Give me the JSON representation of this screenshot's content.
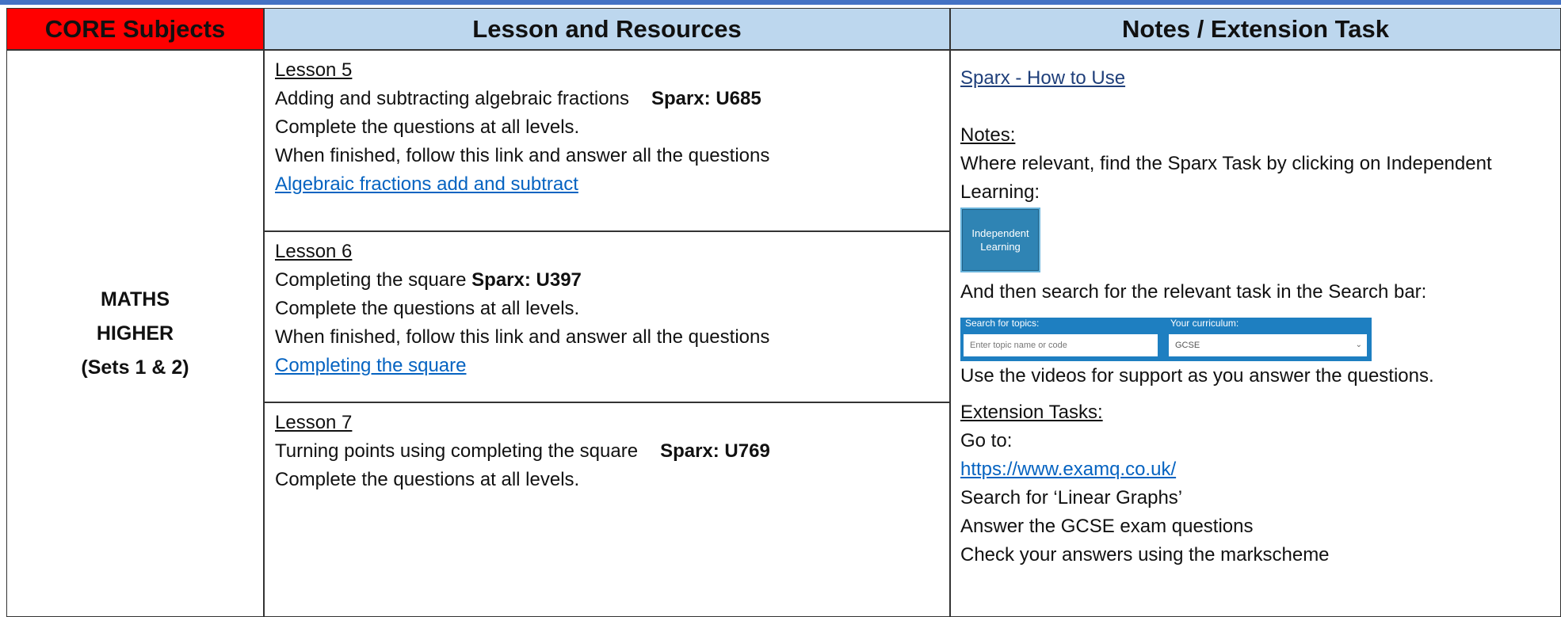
{
  "header": {
    "core": "CORE Subjects",
    "lesson": "Lesson and Resources",
    "notes": "Notes / Extension Task"
  },
  "subject": {
    "line1": "MATHS",
    "line2": "HIGHER",
    "line3": "(Sets 1 & 2)"
  },
  "lessons": [
    {
      "title": "Lesson 5",
      "topic": "Adding and subtracting algebraic fractions",
      "sparx": "Sparx: U685",
      "instruction": "Complete the questions at all levels.",
      "follow": "When finished, follow this link and answer all the questions",
      "link": "Algebraic fractions add and subtract"
    },
    {
      "title": "Lesson 6",
      "topic": "Completing the square",
      "sparx": "Sparx: U397",
      "instruction": "Complete the questions at all levels.",
      "follow": "When finished, follow this link and answer all the questions",
      "link": "Completing the square"
    },
    {
      "title": "Lesson 7",
      "topic": "Turning points using completing the square",
      "sparx": "Sparx: U769",
      "instruction": "Complete the questions at all levels."
    }
  ],
  "notes": {
    "how_to_link": "Sparx - How to Use",
    "notes_heading": "Notes:",
    "where_relevant": "Where relevant, find the Sparx Task by clicking on Independent",
    "learning": "Learning:",
    "il_button_line1": "Independent",
    "il_button_line2": "Learning",
    "search_text": "And then search for the relevant task in the Search bar:",
    "search_topics_label": "Search for topics:",
    "search_placeholder": "Enter topic name or code",
    "curriculum_label": "Your curriculum:",
    "curriculum_value": "GCSE",
    "videos": "Use the videos for support as you answer the questions.",
    "extension_heading": "Extension Tasks:",
    "goto": "Go to:",
    "url": "https://www.examq.co.uk/",
    "search_for": "Search for ‘Linear Graphs’",
    "answer": "Answer the GCSE exam questions",
    "check": "Check your answers using the markscheme"
  }
}
